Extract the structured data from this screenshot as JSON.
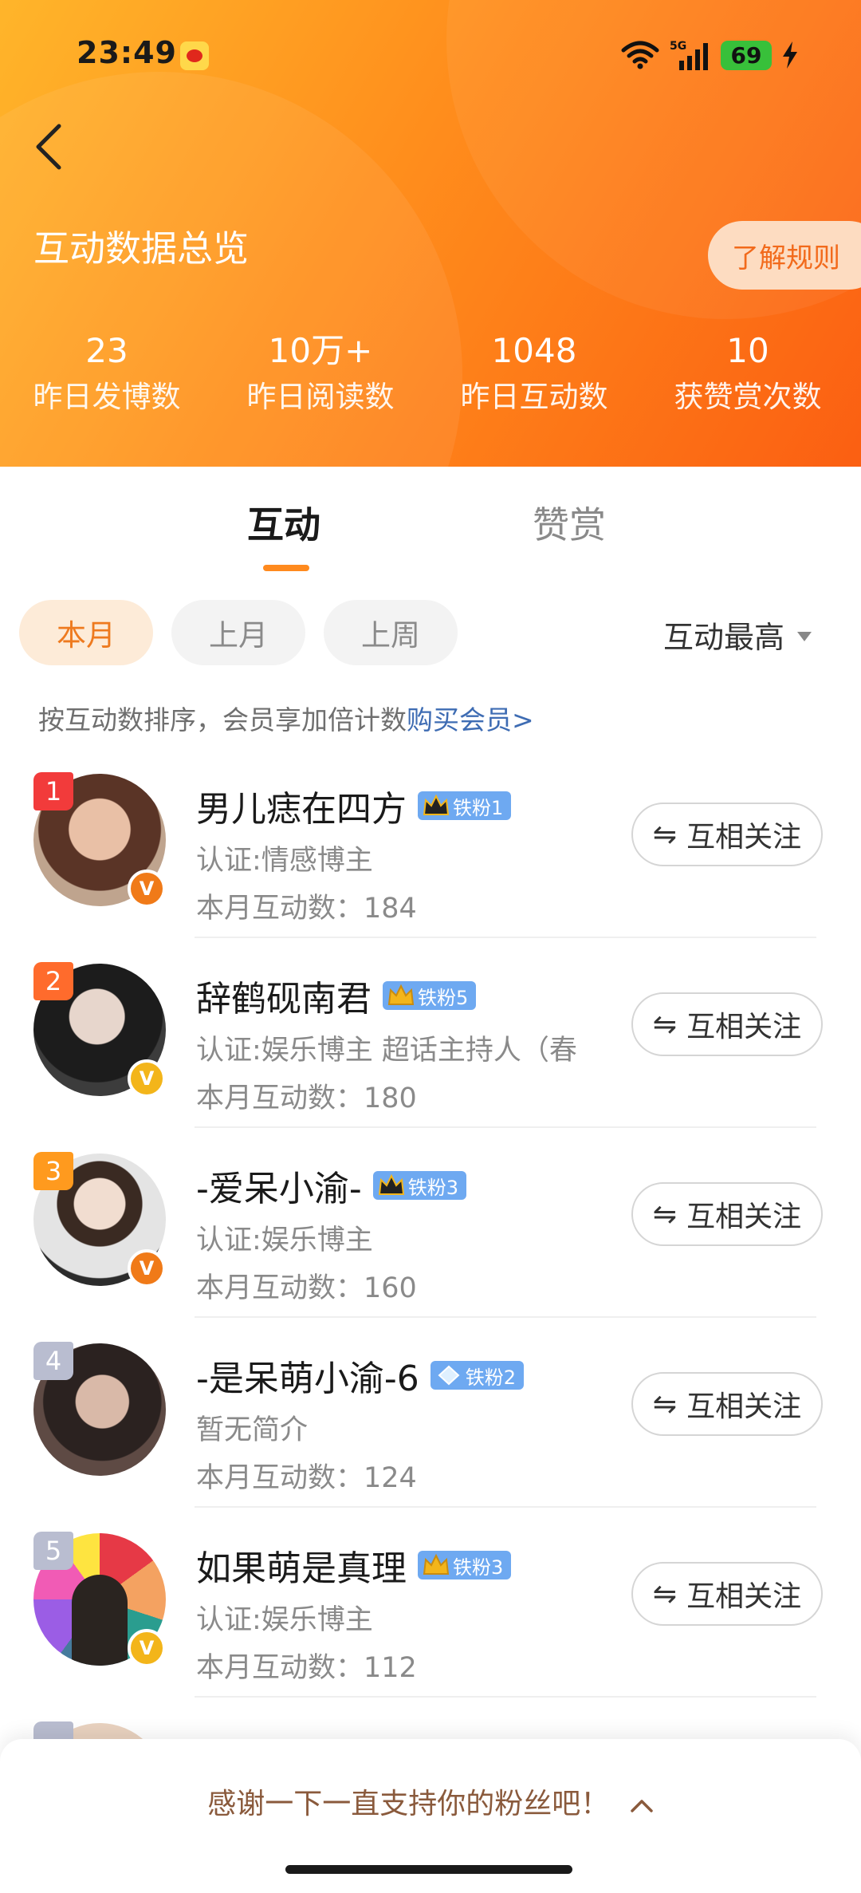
{
  "status_bar": {
    "time": "23:49",
    "network": "5G",
    "battery": "69"
  },
  "header": {
    "title": "互动数据总览",
    "rules_label": "了解规则",
    "stats": [
      {
        "value": "23",
        "label": "昨日发博数"
      },
      {
        "value": "10万+",
        "label": "昨日阅读数"
      },
      {
        "value": "1048",
        "label": "昨日互动数"
      },
      {
        "value": "10",
        "label": "获赞赏次数"
      }
    ]
  },
  "tabs": {
    "interaction": "互动",
    "reward": "赞赏"
  },
  "filters": {
    "this_month": "本月",
    "last_month": "上月",
    "last_week": "上周",
    "sort": "互动最高"
  },
  "hint": {
    "text": "按互动数排序，会员享加倍计数",
    "link": "购买会员>"
  },
  "fans": [
    {
      "rank": "1",
      "name": "男儿痣在四方",
      "badge": "铁粉1",
      "desc": "认证:情感博主",
      "count": "本月互动数：184",
      "follow": "互相关注",
      "rank_color": "#f23b3b",
      "verified_color": "#f07a18"
    },
    {
      "rank": "2",
      "name": "辞鹤砚南君",
      "badge": "铁粉5",
      "desc": "认证:娱乐博主 超话主持人（春",
      "count": "本月互动数：180",
      "follow": "互相关注",
      "rank_color": "#ff6b2c",
      "verified_color": "#f3b51a"
    },
    {
      "rank": "3",
      "name": "-爱呆小渝-",
      "badge": "铁粉3",
      "desc": "认证:娱乐博主",
      "count": "本月互动数：160",
      "follow": "互相关注",
      "rank_color": "#ff9a1e",
      "verified_color": "#f07a18"
    },
    {
      "rank": "4",
      "name": "-是呆萌小渝-6",
      "badge": "铁粉2",
      "desc": "暂无简介",
      "count": "本月互动数：124",
      "follow": "互相关注",
      "rank_color": "#b9bdd0",
      "verified_color": ""
    },
    {
      "rank": "5",
      "name": "如果萌是真理",
      "badge": "铁粉3",
      "desc": "认证:娱乐博主",
      "count": "本月互动数：112",
      "follow": "互相关注",
      "rank_color": "#b9bdd0",
      "verified_color": "#f3b51a"
    }
  ],
  "bottom_sheet": {
    "text": "感谢一下一直支持你的粉丝吧！"
  }
}
